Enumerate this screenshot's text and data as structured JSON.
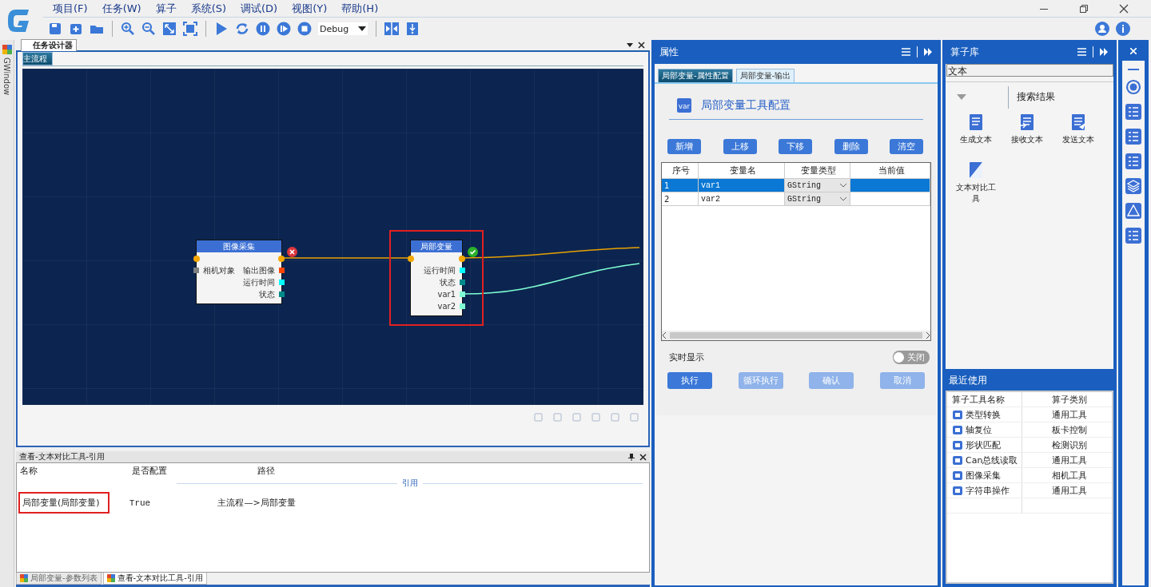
{
  "menu": [
    "项目(F)",
    "任务(W)",
    "算子",
    "系统(S)",
    "调试(D)",
    "视图(Y)",
    "帮助(H)"
  ],
  "toolbar": {
    "mode": "Debug"
  },
  "side_tab": "GWindow",
  "designer": {
    "title": "任务设计器",
    "tabs": [
      {
        "label": "主流程",
        "selected": true
      }
    ],
    "nodes": [
      {
        "title": "图像采集",
        "failed": true,
        "selected": false,
        "inputs": [
          {
            "label": "相机对象",
            "color": "#808080"
          }
        ],
        "outputs": [
          {
            "label": "输出图像",
            "color": "#ff4500"
          },
          {
            "label": "运行时间",
            "color": "#00ffff"
          },
          {
            "label": "状态",
            "color": "#008b8b"
          }
        ]
      },
      {
        "title": "局部变量",
        "failed": false,
        "selected": true,
        "outputs": [
          {
            "label": "运行时间",
            "color": "#00ffff"
          },
          {
            "label": "状态",
            "color": "#008b8b"
          },
          {
            "label": "var1",
            "color": "#7fffd4"
          },
          {
            "label": "var2",
            "color": "#7fffd4"
          }
        ]
      }
    ]
  },
  "reference_panel": {
    "title": "查看-文本对比工具-引用",
    "columns": [
      "名称",
      "是否配置",
      "路径"
    ],
    "group": "引用",
    "rows": [
      {
        "name": "局部变量(局部变量)",
        "configured": "True",
        "path": "主流程—>局部变量",
        "highlighted": true
      }
    ],
    "tabs": [
      {
        "label": "局部变量-参数列表",
        "selected": false
      },
      {
        "label": "查看-文本对比工具-引用",
        "selected": true
      }
    ]
  },
  "properties": {
    "title": "属性",
    "tabs": [
      {
        "label": "局部变量-属性配置",
        "selected": true
      },
      {
        "label": "局部变量-输出",
        "selected": false
      }
    ],
    "icon_label": "var",
    "heading": "局部变量工具配置",
    "buttons": [
      "新增",
      "上移",
      "下移",
      "删除",
      "清空"
    ],
    "columns": [
      "序号",
      "变量名",
      "变量类型",
      "当前值"
    ],
    "rows": [
      {
        "index": "1",
        "name": "var1",
        "type": "GString",
        "selected": true
      },
      {
        "index": "2",
        "name": "var2",
        "type": "GString",
        "selected": false
      }
    ],
    "realtime": {
      "label": "实时显示",
      "on": false,
      "state_label": "关闭"
    },
    "actions": [
      {
        "label": "执行",
        "disabled": false
      },
      {
        "label": "循环执行",
        "disabled": true
      },
      {
        "label": "确认",
        "disabled": true
      },
      {
        "label": "取消",
        "disabled": true
      }
    ]
  },
  "library": {
    "title": "算子库",
    "search": "文本",
    "results_label": "搜索结果",
    "tools": [
      {
        "label": "生成文本",
        "kind": "document"
      },
      {
        "label": "接收文本",
        "kind": "receive"
      },
      {
        "label": "发送文本",
        "kind": "send"
      },
      {
        "label": "文本对比工具",
        "kind": "compare"
      }
    ]
  },
  "recent": {
    "title": "最近使用",
    "columns": [
      "算子工具名称",
      "算子类别"
    ],
    "rows": [
      {
        "name": "类型转换",
        "category": "通用工具"
      },
      {
        "name": "轴复位",
        "category": "板卡控制"
      },
      {
        "name": "形状匹配",
        "category": "检测识别"
      },
      {
        "name": "Can总线读取",
        "category": "通用工具"
      },
      {
        "name": "图像采集",
        "category": "相机工具"
      },
      {
        "name": "字符串操作",
        "category": "通用工具"
      }
    ]
  }
}
